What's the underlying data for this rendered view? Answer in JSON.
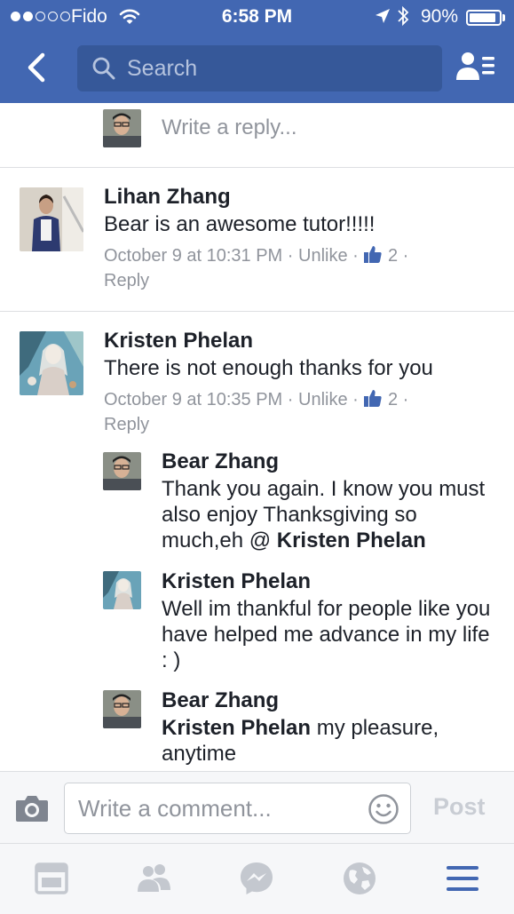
{
  "status_bar": {
    "carrier": "Fido",
    "time": "6:58 PM",
    "battery": "90%",
    "battery_level": 0.9,
    "signal_bars_filled": 2,
    "signal_bars_total": 5
  },
  "nav": {
    "search_placeholder": "Search",
    "icons": [
      "back-chevron-icon",
      "search-icon",
      "friends-list-icon"
    ]
  },
  "top_reply": {
    "placeholder": "Write a reply..."
  },
  "comments": [
    {
      "name": "Lihan Zhang",
      "text": "Bear is an awesome tutor!!!!!",
      "time": "October 9 at 10:31 PM",
      "unlike": "Unlike",
      "likes": "2",
      "reply": "Reply"
    },
    {
      "name": "Kristen Phelan",
      "text": "There is not enough thanks for you",
      "time": "October 9 at 10:35 PM",
      "unlike": "Unlike",
      "likes": "2",
      "reply": "Reply",
      "replies": [
        {
          "name": "Bear Zhang",
          "text_before": "Thank you again. I know you must also enjoy Thanksgiving so much,eh @ ",
          "mention": "Kristen Phelan"
        },
        {
          "name": "Kristen Phelan",
          "text": "Well im thankful for people like you have helped me advance in my life : )"
        },
        {
          "name": "Bear Zhang",
          "mention": "Kristen Phelan",
          "text_after": " my pleasure, anytime"
        }
      ]
    }
  ],
  "separator": "·",
  "composer": {
    "placeholder": "Write a comment...",
    "post_label": "Post"
  },
  "tabbar": {
    "tabs": [
      "news-feed-icon",
      "friends-icon",
      "messenger-icon",
      "notifications-globe-icon",
      "menu-icon"
    ],
    "active": "menu-icon"
  },
  "colors": {
    "brand": "#4267b2",
    "search_bg": "#365899",
    "like_blue": "#4267b2",
    "meta_gray": "#90949c",
    "active_tab": "#4267b2",
    "inactive_tab": "#c4c8cf"
  }
}
